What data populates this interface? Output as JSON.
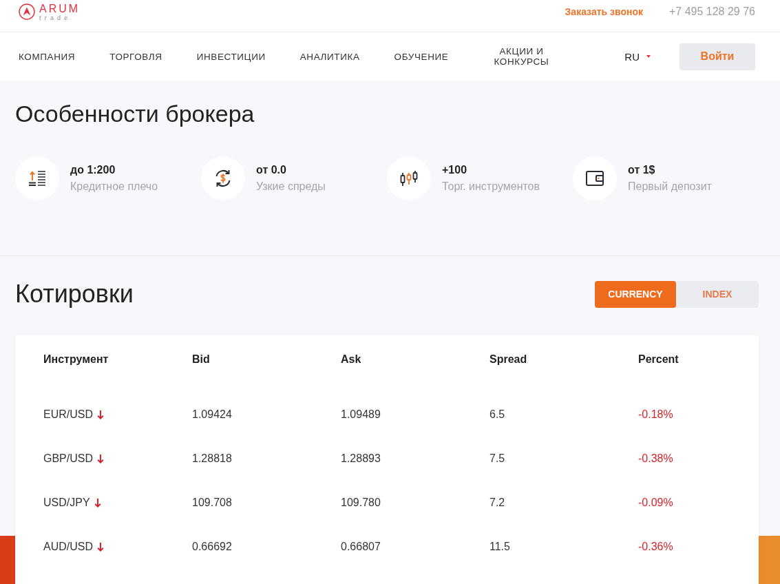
{
  "header": {
    "logo": {
      "name": "ARUM",
      "tagline": "trade"
    },
    "callback_link": "Заказать звонок",
    "phone": "+7 495 128 29 76"
  },
  "nav": {
    "items": [
      "КОМПАНИЯ",
      "ТОРГОВЛЯ",
      "ИНВЕСТИЦИИ",
      "АНАЛИТИКА",
      "ОБУЧЕНИЕ",
      "АКЦИИ И КОНКУРСЫ"
    ],
    "language": "RU",
    "login_button": "Войти"
  },
  "features": {
    "title": "Особенности брокера",
    "items": [
      {
        "kind": "leverage",
        "value": "до 1:200",
        "label": "Кредитное плечо"
      },
      {
        "kind": "spread",
        "value": "от 0.0",
        "label": "Узкие спреды"
      },
      {
        "kind": "instruments",
        "value": "+100",
        "label": "Торг. инструментов"
      },
      {
        "kind": "deposit",
        "value": "от 1$",
        "label": "Первый депозит"
      }
    ]
  },
  "quotes": {
    "title": "Котировки",
    "tabs": [
      {
        "label": "CURRENCY",
        "selected": true
      },
      {
        "label": "INDEX",
        "selected": false
      }
    ],
    "table": {
      "columns": [
        "Инструмент",
        "Bid",
        "Ask",
        "Spread",
        "Percent"
      ],
      "rows": [
        {
          "instrument": "EUR/USD",
          "falling": true,
          "bid": "1.09424",
          "ask": "1.09489",
          "spread": "6.5",
          "percent": "-0.18%"
        },
        {
          "instrument": "GBP/USD",
          "falling": true,
          "bid": "1.28818",
          "ask": "1.28893",
          "spread": "7.5",
          "percent": "-0.38%"
        },
        {
          "instrument": "USD/JPY",
          "falling": true,
          "bid": "109.708",
          "ask": "109.780",
          "spread": "7.2",
          "percent": "-0.09%"
        },
        {
          "instrument": "AUD/USD",
          "falling": true,
          "bid": "0.66692",
          "ask": "0.66807",
          "spread": "11.5",
          "percent": "-0.36%"
        }
      ]
    }
  }
}
